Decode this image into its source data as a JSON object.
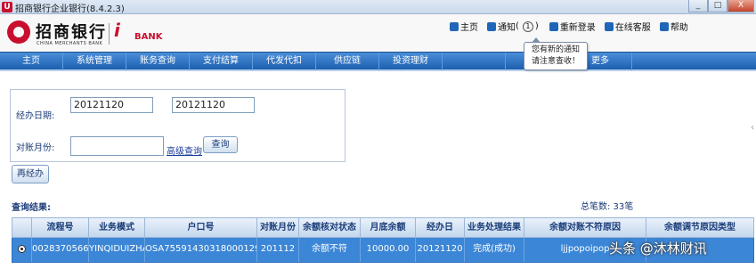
{
  "window": {
    "title": "招商银行企业银行(8.4.2.3)",
    "controls": [
      "_",
      "□",
      "X"
    ]
  },
  "header": {
    "bank_name": "招商银行",
    "bank_name_en": "CHINA MERCHANTS BANK",
    "ibank_i": "i",
    "ibank_text": "BANK",
    "links": {
      "home": "主页",
      "notice": "通知",
      "notice_count_open": "(",
      "notice_count": "1",
      "notice_count_close": ")",
      "relogin": "重新登录",
      "online_service": "在线客服",
      "help": "帮助"
    },
    "tooltip_line1": "您有新的通知",
    "tooltip_line2": "请注意查收！"
  },
  "nav": {
    "items": [
      "主页",
      "系统管理",
      "账务查询",
      "支付结算",
      "代发代扣",
      "供应链",
      "投资理财",
      "",
      "",
      "更多"
    ]
  },
  "form": {
    "date_label": "经办日期:",
    "date_from": "20121120",
    "date_to": "20121120",
    "separator": "-",
    "month_label": "对账月份:",
    "month_value": "",
    "advanced_link": "高级查询",
    "query_button": "查询",
    "reprocess_button": "再经办"
  },
  "results": {
    "title": "查询结果:",
    "total": "总笔数: 33笔",
    "columns": [
      "",
      "流程号",
      "业务模式",
      "户口号",
      "对账月份",
      "余额核对状态",
      "月底余额",
      "经办日",
      "业务处理结果",
      "余额对账不符原因",
      "余额调节原因类型"
    ],
    "rows": [
      [
        "",
        "0028370566",
        "YINQIDUIZHA",
        "OSA75591430318000129",
        "201112",
        "余额不符",
        "10000.00",
        "20121120",
        "完成(成功)",
        "ljjpopoipop",
        ""
      ]
    ]
  },
  "watermark": "头条 @沐林财讯"
}
